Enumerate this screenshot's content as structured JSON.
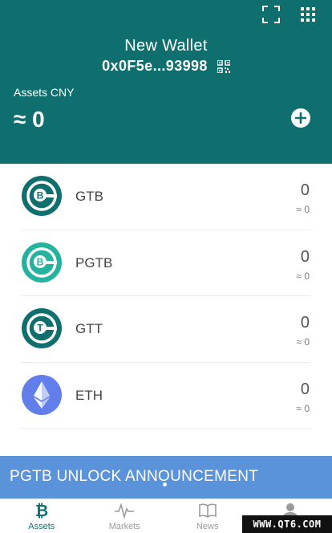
{
  "header": {
    "wallet_name": "New Wallet",
    "wallet_address": "0x0F5e...93998",
    "assets_label": "Assets CNY",
    "assets_value": "≈ 0",
    "icons": [
      "scan-icon",
      "grid-menu-icon",
      "qr-code-icon",
      "add-icon"
    ]
  },
  "assets": [
    {
      "symbol": "GTB",
      "amount": "0",
      "value": "≈ 0",
      "icon": "gtb-logo",
      "color": "#0f6f6f"
    },
    {
      "symbol": "PGTB",
      "amount": "0",
      "value": "≈ 0",
      "icon": "pgtb-logo",
      "color": "#23b39f"
    },
    {
      "symbol": "GTT",
      "amount": "0",
      "value": "≈ 0",
      "icon": "gtt-logo",
      "color": "#0f6f6f"
    },
    {
      "symbol": "ETH",
      "amount": "0",
      "value": "≈ 0",
      "icon": "eth-logo",
      "color": "#627eea"
    }
  ],
  "announcement": {
    "text": "PGTB UNLOCK ANNOUNCEMENT",
    "color": "#5a93d9"
  },
  "tabs": [
    {
      "label": "Assets",
      "icon": "bitcoin-icon",
      "active": true
    },
    {
      "label": "Markets",
      "icon": "pulse-icon",
      "active": false
    },
    {
      "label": "News",
      "icon": "book-icon",
      "active": false
    },
    {
      "label": "",
      "icon": "user-icon",
      "active": false
    }
  ],
  "watermark": "WWW.QT6.COM",
  "colors": {
    "primary": "#0f6f6f",
    "accent": "#23b39f",
    "eth": "#627eea"
  }
}
